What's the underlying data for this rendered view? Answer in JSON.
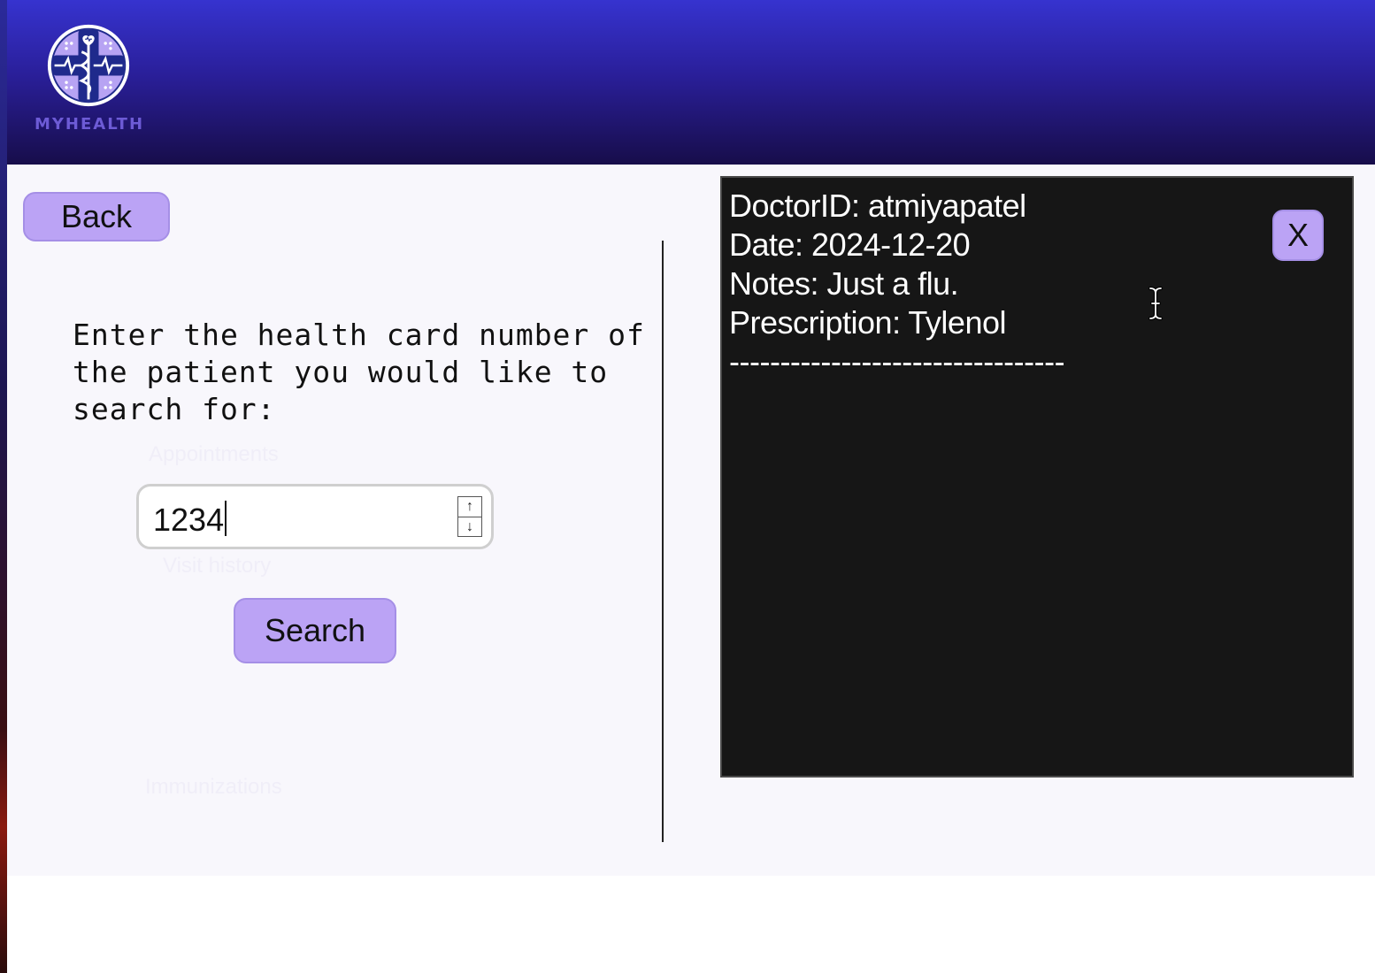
{
  "app": {
    "logo_text": "MYHEALTH"
  },
  "left": {
    "back_label": "Back",
    "prompt": "Enter the health card number of the patient you would like to search for:",
    "input_value": "1234",
    "search_label": "Search",
    "ghost_items": [
      "Appointments",
      "Visit history",
      "Immunizations"
    ]
  },
  "record": {
    "doctor": "DoctorID: atmiyapatel",
    "date": "Date: 2024-12-20",
    "notes": "Notes: Just a flu.",
    "prescription": "Prescription: Tylenol",
    "separator": "---------------------------------",
    "close_label": "X"
  },
  "icons": {
    "logo": "medical-caduceus-icon",
    "stepper_up": "arrow-up-icon",
    "stepper_down": "arrow-down-icon",
    "cursor": "text-cursor-icon"
  },
  "colors": {
    "header_top": "#3633cf",
    "header_bottom": "#170d4a",
    "button": "#bba3f5",
    "panel_bg": "#161616"
  }
}
